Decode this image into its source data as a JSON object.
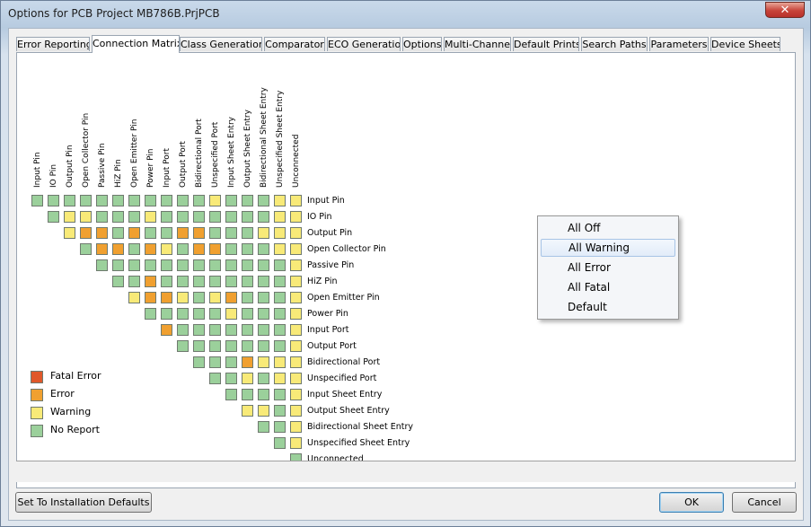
{
  "window": {
    "title": "Options for PCB Project MB786B.PrjPCB",
    "close_glyph": "✕"
  },
  "tabs": [
    {
      "label": "Error Reporting",
      "active": false
    },
    {
      "label": "Connection Matrix",
      "active": true
    },
    {
      "label": "Class Generation",
      "active": false
    },
    {
      "label": "Comparator",
      "active": false
    },
    {
      "label": "ECO Generation",
      "active": false
    },
    {
      "label": "Options",
      "active": false
    },
    {
      "label": "Multi-Channel",
      "active": false
    },
    {
      "label": "Default Prints",
      "active": false
    },
    {
      "label": "Search Paths",
      "active": false
    },
    {
      "label": "Parameters",
      "active": false
    },
    {
      "label": "Device Sheets",
      "active": false
    }
  ],
  "matrix": {
    "pin_types": [
      "Input Pin",
      "IO Pin",
      "Output Pin",
      "Open Collector Pin",
      "Passive Pin",
      "HiZ Pin",
      "Open Emitter Pin",
      "Power Pin",
      "Input Port",
      "Output Port",
      "Bidirectional Port",
      "Unspecified Port",
      "Input Sheet Entry",
      "Output Sheet Entry",
      "Bidirectional Sheet Entry",
      "Unspecified Sheet Entry",
      "Unconnected"
    ],
    "grid": [
      "NNNNNNNNNNNWNNNWW",
      "NWWNNNWNNNNNNNWW",
      "WEENENNEENNNWWW",
      "NEENEWNEENNNWW",
      "NNNNNNNNNNNNW",
      "NNENNNNNNNNW",
      "WEEWNWENNNW",
      "NNNNNWNNNW",
      "ENNNNNNNW",
      "NNNNNNNW",
      "NNNEWWW",
      "NNWNWW",
      "NNNNW",
      "WWNW",
      "NNW",
      "NW",
      "N"
    ]
  },
  "legend": [
    {
      "label": "Fatal Error",
      "code": "F"
    },
    {
      "label": "Error",
      "code": "E"
    },
    {
      "label": "Warning",
      "code": "W"
    },
    {
      "label": "No Report",
      "code": "N"
    }
  ],
  "colors": {
    "F": "#e0582a",
    "E": "#f0a030",
    "W": "#f8ea78",
    "N": "#9bd09b"
  },
  "popup": {
    "items": [
      {
        "label": "All Off",
        "highlighted": false
      },
      {
        "label": "All Warning",
        "highlighted": true
      },
      {
        "label": "All Error",
        "highlighted": false
      },
      {
        "label": "All Fatal",
        "highlighted": false
      },
      {
        "label": "Default",
        "highlighted": false
      }
    ]
  },
  "buttons": {
    "defaults": "Set To Installation Defaults",
    "ok": "OK",
    "cancel": "Cancel"
  }
}
